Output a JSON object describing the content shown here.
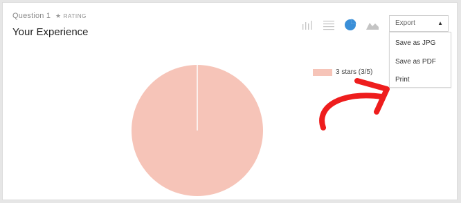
{
  "question": {
    "number_label": "Question 1",
    "type_label": "RATING",
    "title": "Your Experience"
  },
  "toolbar": {
    "icons": [
      "bar-chart-icon",
      "list-icon",
      "pie-chart-icon",
      "area-chart-icon"
    ],
    "active_icon": "pie-chart-icon",
    "export_label": "Export"
  },
  "export_menu": {
    "items": [
      "Save as JPG",
      "Save as PDF",
      "Print"
    ]
  },
  "chart_data": {
    "type": "pie",
    "slices": [
      {
        "label": "3 stars (3/5)",
        "value": 1,
        "color": "#f6c4b8"
      }
    ]
  },
  "colors": {
    "accent": "#3a8fd8",
    "icon_inactive": "#c4c4c4",
    "annotation_arrow": "#ee1d1d"
  }
}
